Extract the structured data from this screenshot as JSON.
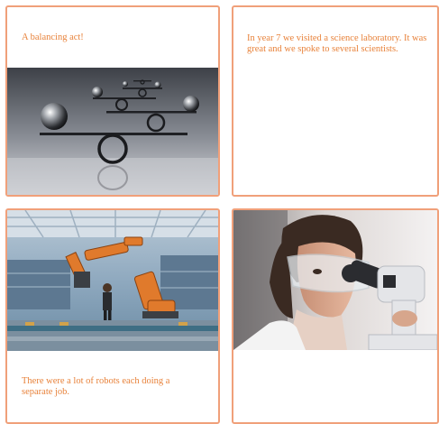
{
  "cards": [
    {
      "text": "A balancing act!",
      "image": "balancing-spheres-photo"
    },
    {
      "text": "In year 7 we visited a science laboratory. It was great and we spoke to several scientists."
    },
    {
      "text": "There were a lot of robots each doing a separate job.",
      "image": "factory-robots-photo"
    },
    {
      "text": "",
      "image": "scientist-microscope-photo"
    }
  ],
  "colors": {
    "text": "#e8823a",
    "border": "#f0a07a"
  }
}
